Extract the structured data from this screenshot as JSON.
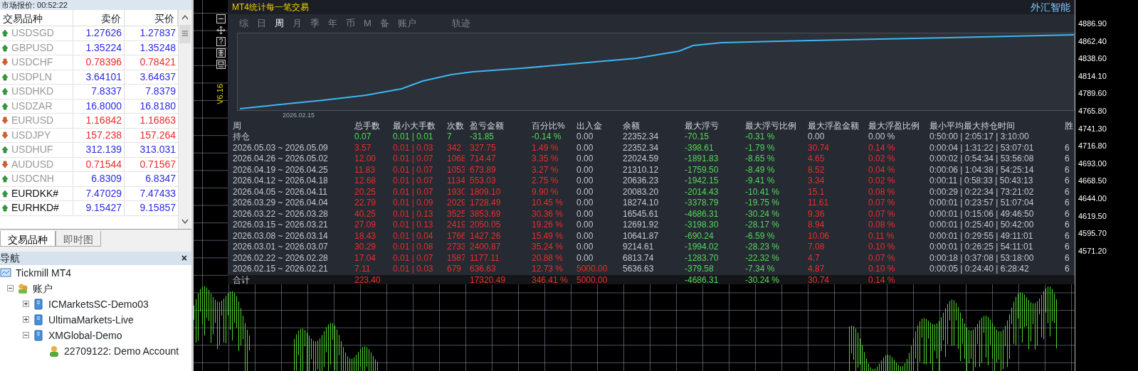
{
  "market_watch": {
    "title": "市场报价: 00:52:22",
    "columns": [
      "交易品种",
      "卖价",
      "买价"
    ],
    "rows": [
      {
        "symbol": "USDSGD",
        "kind": "up",
        "dimmed": true,
        "bid": "1.27626",
        "ask": "1.27837"
      },
      {
        "symbol": "GBPUSD",
        "kind": "up",
        "dimmed": true,
        "bid": "1.35224",
        "ask": "1.35248"
      },
      {
        "symbol": "USDCHF",
        "kind": "down",
        "dimmed": true,
        "bid": "0.78396",
        "ask": "0.78421"
      },
      {
        "symbol": "USDPLN",
        "kind": "up",
        "dimmed": true,
        "bid": "3.64101",
        "ask": "3.64637"
      },
      {
        "symbol": "USDHKD",
        "kind": "up",
        "dimmed": true,
        "bid": "7.8337",
        "ask": "7.8379"
      },
      {
        "symbol": "USDZAR",
        "kind": "up",
        "dimmed": true,
        "bid": "16.8000",
        "ask": "16.8180"
      },
      {
        "symbol": "EURUSD",
        "kind": "down",
        "dimmed": true,
        "bid": "1.16842",
        "ask": "1.16863"
      },
      {
        "symbol": "USDJPY",
        "kind": "down",
        "dimmed": true,
        "bid": "157.238",
        "ask": "157.264"
      },
      {
        "symbol": "USDHUF",
        "kind": "up",
        "dimmed": true,
        "bid": "312.139",
        "ask": "313.031"
      },
      {
        "symbol": "AUDUSD",
        "kind": "down",
        "dimmed": true,
        "bid": "0.71544",
        "ask": "0.71567"
      },
      {
        "symbol": "USDCNH",
        "kind": "up",
        "dimmed": true,
        "bid": "6.8309",
        "ask": "6.8347"
      },
      {
        "symbol": "EURDKK#",
        "kind": "up",
        "dimmed": false,
        "bid": "7.47029",
        "ask": "7.47433"
      },
      {
        "symbol": "EURHKD#",
        "kind": "up",
        "dimmed": false,
        "bid": "9.15427",
        "ask": "9.15857"
      }
    ],
    "tabs": [
      {
        "label": "交易品种",
        "selected": true
      },
      {
        "label": "即时图",
        "selected": false
      }
    ]
  },
  "navigator": {
    "title": "导航",
    "close": "×",
    "tree": [
      {
        "label": "Tickmill MT4",
        "kind": "terminal",
        "children": [
          {
            "label": "账户",
            "kind": "accounts",
            "expanded": true,
            "children": [
              {
                "label": "ICMarketsSC-Demo03",
                "kind": "server",
                "expanded": false
              },
              {
                "label": "UltimaMarkets-Live",
                "kind": "server",
                "expanded": false
              },
              {
                "label": "XMGlobal-Demo",
                "kind": "server",
                "expanded": true,
                "children": [
                  {
                    "label": "22709122: Demo Account",
                    "kind": "account"
                  }
                ]
              }
            ]
          }
        ]
      }
    ]
  },
  "stats_panel": {
    "title": "MT4统计每一笔交易",
    "brand": "外汇智能",
    "version": "V6.16",
    "help": "?",
    "tabs": [
      {
        "label": "综",
        "selected": false
      },
      {
        "label": "日",
        "selected": false
      },
      {
        "label": "周",
        "selected": true
      },
      {
        "label": "月",
        "selected": false
      },
      {
        "label": "季",
        "selected": false
      },
      {
        "label": "年",
        "selected": false
      },
      {
        "label": "币",
        "selected": false
      },
      {
        "label": "M",
        "selected": false
      },
      {
        "label": "备",
        "selected": false
      },
      {
        "label": "账户",
        "selected": false
      }
    ],
    "trail_tab": "轨迹",
    "equity_start_label": "2026.02.15",
    "columns": [
      "周",
      "总手数",
      "最小大手数",
      "次数",
      "盈亏金额",
      "百分比%",
      "出入金",
      "余额",
      "最大浮亏",
      "最大浮亏比例",
      "最大浮盈金额",
      "最大浮盈比例",
      "最小平均最大持仓时间",
      "胜"
    ],
    "rows": [
      {
        "kind": "open",
        "cells": [
          {
            "text": "持仓",
            "kind": "plain"
          },
          {
            "text": "0.07",
            "kind": "down"
          },
          {
            "text": "0.01 | 0.01",
            "kind": "down"
          },
          {
            "text": "7",
            "kind": "down"
          },
          {
            "text": "-31.85",
            "kind": "down"
          },
          {
            "text": "-0.14 %",
            "kind": "down"
          },
          {
            "text": "0.00",
            "kind": "plain"
          },
          {
            "text": "22352.34",
            "kind": "plain"
          },
          {
            "text": "-70.15",
            "kind": "down"
          },
          {
            "text": "-0.31 %",
            "kind": "down"
          },
          {
            "text": "0.00",
            "kind": "plain"
          },
          {
            "text": "0.00 %",
            "kind": "plain"
          },
          {
            "text": "0:50:00 | 2:05:17 | 3:10:00",
            "kind": "plain"
          }
        ]
      },
      {
        "kind": "week",
        "cells": [
          {
            "text": "2026.05.03 ~ 2026.05.09",
            "kind": "plain"
          },
          {
            "text": "3.57",
            "kind": "up"
          },
          {
            "text": "0.01 | 0.03",
            "kind": "up"
          },
          {
            "text": "342",
            "kind": "up"
          },
          {
            "text": "327.75",
            "kind": "up"
          },
          {
            "text": "1.49 %",
            "kind": "up"
          },
          {
            "text": "0.00",
            "kind": "plain"
          },
          {
            "text": "22352.34",
            "kind": "plain"
          },
          {
            "text": "-398.61",
            "kind": "down"
          },
          {
            "text": "-1.79 %",
            "kind": "down"
          },
          {
            "text": "30.74",
            "kind": "up"
          },
          {
            "text": "0.14 %",
            "kind": "up"
          },
          {
            "text": "0:00:04 | 1:31:22 | 53:07:01",
            "kind": "plain"
          },
          {
            "text": "6",
            "kind": "plain"
          }
        ]
      },
      {
        "kind": "week",
        "cells": [
          {
            "text": "2026.04.26 ~ 2026.05.02",
            "kind": "plain"
          },
          {
            "text": "12.00",
            "kind": "up"
          },
          {
            "text": "0.01 | 0.07",
            "kind": "up"
          },
          {
            "text": "1068",
            "kind": "up"
          },
          {
            "text": "714.47",
            "kind": "up"
          },
          {
            "text": "3.35 %",
            "kind": "up"
          },
          {
            "text": "0.00",
            "kind": "plain"
          },
          {
            "text": "22024.59",
            "kind": "plain"
          },
          {
            "text": "-1891.83",
            "kind": "down"
          },
          {
            "text": "-8.65 %",
            "kind": "down"
          },
          {
            "text": "4.65",
            "kind": "up"
          },
          {
            "text": "0.02 %",
            "kind": "up"
          },
          {
            "text": "0:00:02 | 0:54:34 | 53:56:08",
            "kind": "plain"
          },
          {
            "text": "6",
            "kind": "plain"
          }
        ]
      },
      {
        "kind": "week",
        "cells": [
          {
            "text": "2026.04.19 ~ 2026.04.25",
            "kind": "plain"
          },
          {
            "text": "11.83",
            "kind": "up"
          },
          {
            "text": "0.01 | 0.07",
            "kind": "up"
          },
          {
            "text": "1053",
            "kind": "up"
          },
          {
            "text": "673.89",
            "kind": "up"
          },
          {
            "text": "3.27 %",
            "kind": "up"
          },
          {
            "text": "0.00",
            "kind": "plain"
          },
          {
            "text": "21310.12",
            "kind": "plain"
          },
          {
            "text": "-1759.50",
            "kind": "down"
          },
          {
            "text": "-8.49 %",
            "kind": "down"
          },
          {
            "text": "8.52",
            "kind": "up"
          },
          {
            "text": "0.04 %",
            "kind": "up"
          },
          {
            "text": "0:00:06 | 1:04:38 | 54:25:14",
            "kind": "plain"
          },
          {
            "text": "6",
            "kind": "plain"
          }
        ]
      },
      {
        "kind": "week",
        "cells": [
          {
            "text": "2026.04.12 ~ 2026.04.18",
            "kind": "plain"
          },
          {
            "text": "12.68",
            "kind": "up"
          },
          {
            "text": "0.01 | 0.07",
            "kind": "up"
          },
          {
            "text": "1134",
            "kind": "up"
          },
          {
            "text": "553.03",
            "kind": "up"
          },
          {
            "text": "2.75 %",
            "kind": "up"
          },
          {
            "text": "0.00",
            "kind": "plain"
          },
          {
            "text": "20636.23",
            "kind": "plain"
          },
          {
            "text": "-1942.15",
            "kind": "down"
          },
          {
            "text": "-9.41 %",
            "kind": "down"
          },
          {
            "text": "3.34",
            "kind": "up"
          },
          {
            "text": "0.02 %",
            "kind": "up"
          },
          {
            "text": "0:00:11 | 0:58:33 | 50:43:13",
            "kind": "plain"
          },
          {
            "text": "6",
            "kind": "plain"
          }
        ]
      },
      {
        "kind": "week",
        "cells": [
          {
            "text": "2026.04.05 ~ 2026.04.11",
            "kind": "plain"
          },
          {
            "text": "20.25",
            "kind": "up"
          },
          {
            "text": "0.01 | 0.07",
            "kind": "up"
          },
          {
            "text": "1930",
            "kind": "up"
          },
          {
            "text": "1809.10",
            "kind": "up"
          },
          {
            "text": "9.90 %",
            "kind": "up"
          },
          {
            "text": "0.00",
            "kind": "plain"
          },
          {
            "text": "20083.20",
            "kind": "plain"
          },
          {
            "text": "-2014.43",
            "kind": "down"
          },
          {
            "text": "-10.41 %",
            "kind": "down"
          },
          {
            "text": "15.1",
            "kind": "up"
          },
          {
            "text": "0.08 %",
            "kind": "up"
          },
          {
            "text": "0:00:29 | 0:22:34 | 73:21:02",
            "kind": "plain"
          },
          {
            "text": "6",
            "kind": "plain"
          }
        ]
      },
      {
        "kind": "week",
        "cells": [
          {
            "text": "2026.03.29 ~ 2026.04.04",
            "kind": "plain"
          },
          {
            "text": "22.79",
            "kind": "up"
          },
          {
            "text": "0.01 | 0.09",
            "kind": "up"
          },
          {
            "text": "2029",
            "kind": "up"
          },
          {
            "text": "1728.49",
            "kind": "up"
          },
          {
            "text": "10.45 %",
            "kind": "up"
          },
          {
            "text": "0.00",
            "kind": "plain"
          },
          {
            "text": "18274.10",
            "kind": "plain"
          },
          {
            "text": "-3378.79",
            "kind": "down"
          },
          {
            "text": "-19.75 %",
            "kind": "down"
          },
          {
            "text": "11.61",
            "kind": "up"
          },
          {
            "text": "0.07 %",
            "kind": "up"
          },
          {
            "text": "0:00:01 | 0:23:57 | 51:07:04",
            "kind": "plain"
          },
          {
            "text": "6",
            "kind": "plain"
          }
        ]
      },
      {
        "kind": "week",
        "cells": [
          {
            "text": "2026.03.22 ~ 2026.03.28",
            "kind": "plain"
          },
          {
            "text": "40.25",
            "kind": "up"
          },
          {
            "text": "0.01 | 0.13",
            "kind": "up"
          },
          {
            "text": "3525",
            "kind": "up"
          },
          {
            "text": "3853.69",
            "kind": "up"
          },
          {
            "text": "30.36 %",
            "kind": "up"
          },
          {
            "text": "0.00",
            "kind": "plain"
          },
          {
            "text": "16545.61",
            "kind": "plain"
          },
          {
            "text": "-4686.31",
            "kind": "down"
          },
          {
            "text": "-30.24 %",
            "kind": "down"
          },
          {
            "text": "9.36",
            "kind": "up"
          },
          {
            "text": "0.07 %",
            "kind": "up"
          },
          {
            "text": "0:00:01 | 0:15:06 | 49:46:50",
            "kind": "plain"
          },
          {
            "text": "6",
            "kind": "plain"
          }
        ]
      },
      {
        "kind": "week",
        "cells": [
          {
            "text": "2026.03.15 ~ 2026.03.21",
            "kind": "plain"
          },
          {
            "text": "27.09",
            "kind": "up"
          },
          {
            "text": "0.01 | 0.13",
            "kind": "up"
          },
          {
            "text": "2419",
            "kind": "up"
          },
          {
            "text": "2050.05",
            "kind": "up"
          },
          {
            "text": "19.26 %",
            "kind": "up"
          },
          {
            "text": "0.00",
            "kind": "plain"
          },
          {
            "text": "12691.92",
            "kind": "plain"
          },
          {
            "text": "-3198.30",
            "kind": "down"
          },
          {
            "text": "-28.17 %",
            "kind": "down"
          },
          {
            "text": "8.94",
            "kind": "up"
          },
          {
            "text": "0.08 %",
            "kind": "up"
          },
          {
            "text": "0:00:01 | 0:25:40 | 50:42:00",
            "kind": "plain"
          },
          {
            "text": "6",
            "kind": "plain"
          }
        ]
      },
      {
        "kind": "week",
        "cells": [
          {
            "text": "2026.03.08 ~ 2026.03.14",
            "kind": "plain"
          },
          {
            "text": "18.43",
            "kind": "up"
          },
          {
            "text": "0.01 | 0.04",
            "kind": "up"
          },
          {
            "text": "1766",
            "kind": "up"
          },
          {
            "text": "1427.26",
            "kind": "up"
          },
          {
            "text": "15.49 %",
            "kind": "up"
          },
          {
            "text": "0.00",
            "kind": "plain"
          },
          {
            "text": "10641.87",
            "kind": "plain"
          },
          {
            "text": "-690.24",
            "kind": "down"
          },
          {
            "text": "-6.59 %",
            "kind": "down"
          },
          {
            "text": "10.06",
            "kind": "up"
          },
          {
            "text": "0.11 %",
            "kind": "up"
          },
          {
            "text": "0:00:01 | 0:29:55 | 49:11:01",
            "kind": "plain"
          },
          {
            "text": "6",
            "kind": "plain"
          }
        ]
      },
      {
        "kind": "week",
        "cells": [
          {
            "text": "2026.03.01 ~ 2026.03.07",
            "kind": "plain"
          },
          {
            "text": "30.29",
            "kind": "up"
          },
          {
            "text": "0.01 | 0.08",
            "kind": "up"
          },
          {
            "text": "2733",
            "kind": "up"
          },
          {
            "text": "2400.87",
            "kind": "up"
          },
          {
            "text": "35.24 %",
            "kind": "up"
          },
          {
            "text": "0.00",
            "kind": "plain"
          },
          {
            "text": "9214.61",
            "kind": "plain"
          },
          {
            "text": "-1994.02",
            "kind": "down"
          },
          {
            "text": "-28.23 %",
            "kind": "down"
          },
          {
            "text": "7.08",
            "kind": "up"
          },
          {
            "text": "0.10 %",
            "kind": "up"
          },
          {
            "text": "0:00:01 | 0:26:25 | 54:11:01",
            "kind": "plain"
          },
          {
            "text": "6",
            "kind": "plain"
          }
        ]
      },
      {
        "kind": "week",
        "cells": [
          {
            "text": "2026.02.22 ~ 2026.02.28",
            "kind": "plain"
          },
          {
            "text": "17.04",
            "kind": "up"
          },
          {
            "text": "0.01 | 0.07",
            "kind": "up"
          },
          {
            "text": "1587",
            "kind": "up"
          },
          {
            "text": "1177.11",
            "kind": "up"
          },
          {
            "text": "20.88 %",
            "kind": "up"
          },
          {
            "text": "0.00",
            "kind": "plain"
          },
          {
            "text": "6813.74",
            "kind": "plain"
          },
          {
            "text": "-1283.70",
            "kind": "down"
          },
          {
            "text": "-22.32 %",
            "kind": "down"
          },
          {
            "text": "4.7",
            "kind": "up"
          },
          {
            "text": "0.07 %",
            "kind": "up"
          },
          {
            "text": "0:00:18 | 0:37:08 | 53:18:00",
            "kind": "plain"
          },
          {
            "text": "6",
            "kind": "plain"
          }
        ]
      },
      {
        "kind": "week",
        "cells": [
          {
            "text": "2026.02.15 ~ 2026.02.21",
            "kind": "plain"
          },
          {
            "text": "7.11",
            "kind": "up"
          },
          {
            "text": "0.01 | 0.03",
            "kind": "up"
          },
          {
            "text": "679",
            "kind": "up"
          },
          {
            "text": "636.63",
            "kind": "up"
          },
          {
            "text": "12.73 %",
            "kind": "up"
          },
          {
            "text": "5000.00",
            "kind": "up"
          },
          {
            "text": "5636.63",
            "kind": "plain"
          },
          {
            "text": "-379.58",
            "kind": "down"
          },
          {
            "text": "-7.34 %",
            "kind": "down"
          },
          {
            "text": "4.87",
            "kind": "up"
          },
          {
            "text": "0.10 %",
            "kind": "up"
          },
          {
            "text": "0:00:05 | 0:24:40 | 6:28:42",
            "kind": "plain"
          },
          {
            "text": "6",
            "kind": "plain"
          }
        ]
      },
      {
        "kind": "total",
        "cells": [
          {
            "text": "合计",
            "kind": "plain"
          },
          {
            "text": "223.40",
            "kind": "up"
          },
          null,
          null,
          {
            "text": "17320.49",
            "kind": "up"
          },
          {
            "text": "346.41 %",
            "kind": "up"
          },
          {
            "text": "5000.00",
            "kind": "up"
          },
          null,
          {
            "text": "-4686.31",
            "kind": "down"
          },
          {
            "text": "-30.24 %",
            "kind": "down"
          },
          {
            "text": "30.74",
            "kind": "up"
          },
          {
            "text": "0.14 %",
            "kind": "up"
          }
        ]
      }
    ]
  },
  "price_axis": [
    "4886.90",
    "4862.40",
    "4838.60",
    "4814.10",
    "4789.60",
    "4765.80",
    "4741.30",
    "4716.80",
    "4693.00",
    "4668.50",
    "4644.00",
    "4619.50",
    "4595.70",
    "4571.20"
  ]
}
